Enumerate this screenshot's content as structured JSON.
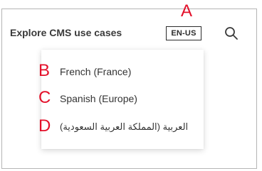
{
  "header": {
    "title": "Explore CMS use cases",
    "language_button": "EN-US",
    "search_icon": "search-icon"
  },
  "dropdown": {
    "options": [
      {
        "label": "French (France)"
      },
      {
        "label": "Spanish (Europe)"
      },
      {
        "label": "العربية (المملكة العربية السعودية)"
      }
    ]
  },
  "annotations": {
    "a": "A",
    "b": "B",
    "c": "C",
    "d": "D"
  },
  "colors": {
    "annotation": "#e3102a",
    "border": "#b5b5b5",
    "text": "#3a3a3a"
  }
}
